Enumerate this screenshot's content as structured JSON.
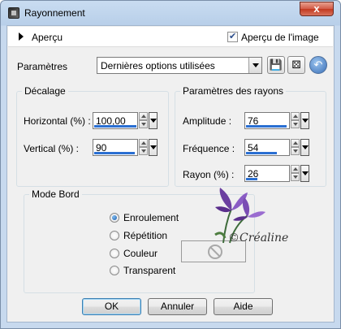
{
  "window": {
    "title": "Rayonnement",
    "close_label": "x"
  },
  "preview": {
    "label": "Aperçu",
    "image_preview_label": "Aperçu de l'image",
    "image_preview_checked": true
  },
  "presets": {
    "label": "Paramètres",
    "value": "Dernières options utilisées"
  },
  "offset": {
    "title": "Décalage",
    "horizontal": {
      "label": "Horizontal (%) :",
      "value": "100,00",
      "level": 1.0
    },
    "vertical": {
      "label": "Vertical (%) :",
      "value": "90",
      "level": 0.95
    }
  },
  "rays": {
    "title": "Paramètres des rayons",
    "amplitude": {
      "label": "Amplitude :",
      "value": "76",
      "level": 0.95
    },
    "frequency": {
      "label": "Fréquence :",
      "value": "54",
      "level": 0.7
    },
    "radius": {
      "label": "Rayon (%) :",
      "value": "26",
      "level": 0.26
    }
  },
  "edge_mode": {
    "title": "Mode Bord",
    "options": [
      "Enroulement",
      "Répétition",
      "Couleur",
      "Transparent"
    ],
    "selected": "Enroulement"
  },
  "watermark": {
    "text": "©Créaline"
  },
  "buttons": {
    "ok": "OK",
    "cancel": "Annuler",
    "help": "Aide"
  }
}
